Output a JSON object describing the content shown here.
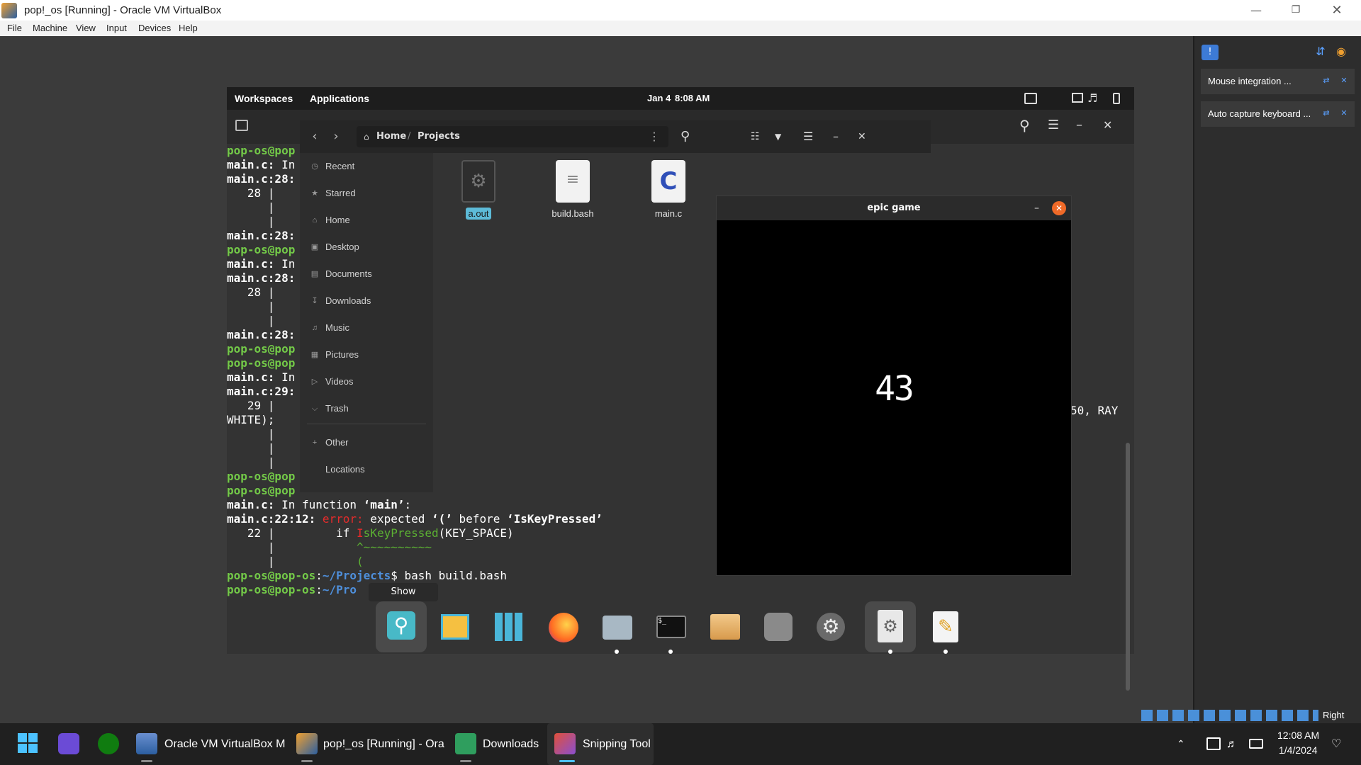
{
  "vbox": {
    "title": "pop!_os [Running] - Oracle VM VirtualBox",
    "menu": [
      "File",
      "Machine",
      "View",
      "Input",
      "Devices",
      "Help"
    ]
  },
  "mini_toolbar": {
    "items": [
      "Mouse integration ...",
      "Auto capture keyboard ..."
    ]
  },
  "guest_topbar": {
    "workspaces": "Workspaces",
    "applications": "Applications",
    "date": "Jan 4",
    "time": "8:08 AM"
  },
  "terminal": {
    "lines": [
      {
        "segments": [
          {
            "t": "pop-os@pop",
            "c": "g"
          }
        ]
      },
      {
        "segments": [
          {
            "t": "main.c:",
            "c": "bold"
          },
          {
            "t": " In",
            "c": ""
          }
        ]
      },
      {
        "segments": [
          {
            "t": "main.c:28:",
            "c": "bold"
          }
        ]
      },
      {
        "segments": [
          {
            "t": "   28 |",
            "c": ""
          }
        ]
      },
      {
        "segments": [
          {
            "t": "      |",
            "c": ""
          }
        ]
      },
      {
        "segments": [
          {
            "t": "      |",
            "c": ""
          }
        ]
      },
      {
        "segments": [
          {
            "t": "main.c:28:",
            "c": "bold"
          }
        ]
      },
      {
        "segments": [
          {
            "t": "pop-os@pop",
            "c": "g"
          }
        ]
      },
      {
        "segments": [
          {
            "t": "main.c:",
            "c": "bold"
          },
          {
            "t": " In",
            "c": ""
          }
        ]
      },
      {
        "segments": [
          {
            "t": "main.c:28:",
            "c": "bold"
          }
        ]
      },
      {
        "segments": [
          {
            "t": "   28 |",
            "c": ""
          }
        ]
      },
      {
        "segments": [
          {
            "t": "      |",
            "c": ""
          }
        ]
      },
      {
        "segments": [
          {
            "t": "      |",
            "c": ""
          }
        ]
      },
      {
        "segments": [
          {
            "t": "main.c:28:",
            "c": "bold"
          }
        ]
      },
      {
        "segments": [
          {
            "t": "pop-os@pop",
            "c": "g"
          }
        ]
      },
      {
        "segments": [
          {
            "t": "pop-os@pop",
            "c": "g"
          }
        ]
      },
      {
        "segments": [
          {
            "t": "main.c:",
            "c": "bold"
          },
          {
            "t": " In",
            "c": ""
          }
        ]
      },
      {
        "segments": [
          {
            "t": "main.c:29:",
            "c": "bold"
          }
        ]
      },
      {
        "segments": [
          {
            "t": "   29 |",
            "c": ""
          }
        ]
      },
      {
        "segments": [
          {
            "t": "WHITE);",
            "c": ""
          }
        ]
      },
      {
        "segments": [
          {
            "t": "      |",
            "c": ""
          }
        ]
      },
      {
        "segments": [
          {
            "t": "      |",
            "c": ""
          }
        ]
      },
      {
        "segments": [
          {
            "t": "      |",
            "c": ""
          }
        ]
      },
      {
        "segments": [
          {
            "t": "pop-os@pop",
            "c": "g"
          }
        ]
      },
      {
        "segments": [
          {
            "t": "pop-os@pop",
            "c": "g"
          }
        ]
      },
      {
        "segments": [
          {
            "t": "main.c:",
            "c": "bold"
          },
          {
            "t": " In function ",
            "c": ""
          },
          {
            "t": "‘main’",
            "c": "bold"
          },
          {
            "t": ":",
            "c": ""
          }
        ]
      },
      {
        "segments": [
          {
            "t": "main.c:22:12: ",
            "c": "bold"
          },
          {
            "t": "error: ",
            "c": "red"
          },
          {
            "t": "expected ",
            "c": ""
          },
          {
            "t": "‘(’",
            "c": "bold"
          },
          {
            "t": " before ",
            "c": ""
          },
          {
            "t": "‘IsKeyPressed’",
            "c": "bold"
          }
        ]
      },
      {
        "segments": [
          {
            "t": "   22 |         if ",
            "c": ""
          },
          {
            "t": "I",
            "c": "red"
          },
          {
            "t": "sKeyPressed",
            "c": "grn"
          },
          {
            "t": "(KEY_SPACE)",
            "c": ""
          }
        ]
      },
      {
        "segments": [
          {
            "t": "      |            ",
            "c": ""
          },
          {
            "t": "^~~~~~~~~~~",
            "c": "grn"
          }
        ]
      },
      {
        "segments": [
          {
            "t": "      |            ",
            "c": ""
          },
          {
            "t": "(",
            "c": "grn"
          }
        ]
      },
      {
        "segments": [
          {
            "t": "pop-os@pop-os",
            "c": "g"
          },
          {
            "t": ":",
            "c": ""
          },
          {
            "t": "~/Projects",
            "c": "b"
          },
          {
            "t": "$ bash build.bash",
            "c": ""
          }
        ]
      },
      {
        "segments": [
          {
            "t": "pop-os@pop-os",
            "c": "g"
          },
          {
            "t": ":",
            "c": ""
          },
          {
            "t": "~/Pro",
            "c": "b"
          }
        ]
      }
    ],
    "right_fragment": "50, RAY"
  },
  "files": {
    "breadcrumb": [
      "Home",
      "Projects"
    ],
    "sidebar": [
      "Recent",
      "Starred",
      "Home",
      "Desktop",
      "Documents",
      "Downloads",
      "Music",
      "Pictures",
      "Videos",
      "Trash",
      "Other Locations"
    ],
    "items": [
      "a.out",
      "build.bash",
      "main.c"
    ]
  },
  "game": {
    "title": "epic game",
    "score": "43"
  },
  "dock": {
    "tooltip": "Show Launcher"
  },
  "taskbar": {
    "items": [
      "Oracle VM VirtualBox M",
      "pop!_os [Running] - Ora",
      "Downloads",
      "Snipping Tool"
    ],
    "time": "12:08 AM",
    "date": "1/4/2024",
    "host_key": "Right Ctrl"
  }
}
